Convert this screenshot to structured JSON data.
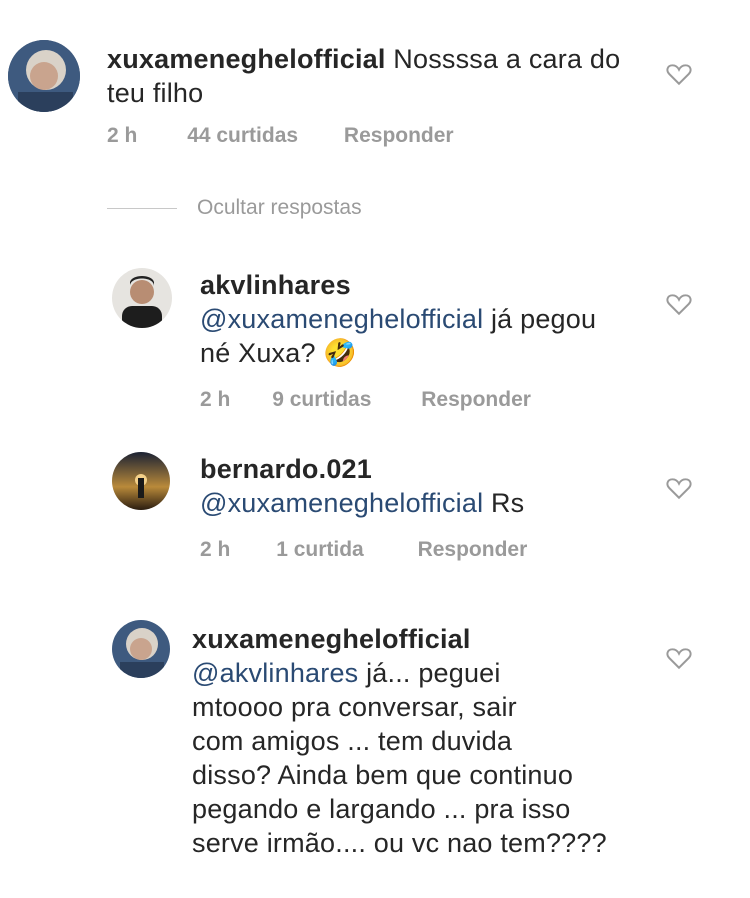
{
  "comments": [
    {
      "username": "xuxameneghelofficial",
      "text_parts": [
        "Nossssa a cara do",
        "teu filho"
      ],
      "mention": "",
      "time": "2 h",
      "likes": "44 curtidas",
      "reply": "Responder"
    },
    {
      "username": "akvlinhares",
      "mention": "@xuxameneghelofficial",
      "text_parts": [
        " já pegou",
        "né Xuxa? 🤣"
      ],
      "time": "2 h",
      "likes": "9 curtidas",
      "reply": "Responder"
    },
    {
      "username": "bernardo.021",
      "mention": "@xuxameneghelofficial",
      "text_parts": [
        " Rs"
      ],
      "time": "2 h",
      "likes": "1 curtida",
      "reply": "Responder"
    },
    {
      "username": "xuxameneghelofficial",
      "mention": "@akvlinhares",
      "text_parts": [
        " já... peguei",
        "mtoooo pra conversar, sair",
        "com amigos ... tem duvida",
        "disso? Ainda bem que continuo",
        "pegando e largando ... pra isso",
        "serve irmão.... ou vc nao tem????"
      ]
    }
  ],
  "hide_replies": "Ocultar respostas",
  "icons": {
    "like": "heart-icon"
  }
}
